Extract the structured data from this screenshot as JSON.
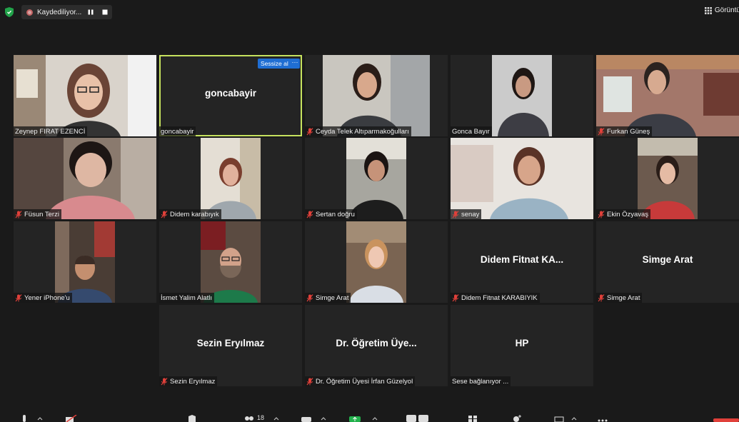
{
  "top": {
    "recording_label": "Kaydediliyor...",
    "view_label": "Görüntü",
    "colors": {
      "rec": "#c46464",
      "shield": "#22a34a"
    }
  },
  "participants": [
    {
      "name": "Zeynep FIRAT EZENCİ",
      "muted": false,
      "center": ""
    },
    {
      "name": "goncabayir",
      "muted": false,
      "center": "goncabayir",
      "active": true,
      "mute_button": "Sessize al",
      "more_button": "···"
    },
    {
      "name": "Ceyda Telek Altıparmakoğulları",
      "muted": true,
      "center": ""
    },
    {
      "name": "Gonca Bayır",
      "muted": false,
      "center": ""
    },
    {
      "name": "Furkan Güneş",
      "muted": true,
      "center": ""
    },
    {
      "name": "Füsun Terzi",
      "muted": true,
      "center": ""
    },
    {
      "name": "Didem karabıyık",
      "muted": true,
      "center": ""
    },
    {
      "name": "Sertan doğru",
      "muted": true,
      "center": ""
    },
    {
      "name": "senay",
      "muted": true,
      "center": ""
    },
    {
      "name": "Ekin Özyavaş",
      "muted": true,
      "center": ""
    },
    {
      "name": "Yener iPhone'u",
      "muted": true,
      "center": ""
    },
    {
      "name": "İsmet Yalim Alatlı",
      "muted": false,
      "center": ""
    },
    {
      "name": "Simge Arat",
      "muted": true,
      "center": ""
    },
    {
      "name": "Didem Fitnat KARABIYIK",
      "muted": true,
      "center": "Didem Fitnat KA..."
    },
    {
      "name": "Simge Arat",
      "muted": true,
      "center": "Simge Arat"
    },
    {
      "name": "Sezin Eryılmaz",
      "muted": true,
      "center": "Sezin Eryılmaz"
    },
    {
      "name": "Dr. Öğretim Üyesi İrfan Güzelyol",
      "muted": true,
      "center": "Dr. Öğretim Üye..."
    },
    {
      "name": "Sese bağlanıyor ...",
      "muted": false,
      "center": "HP"
    }
  ],
  "toolbar": {
    "participant_count": "18"
  }
}
